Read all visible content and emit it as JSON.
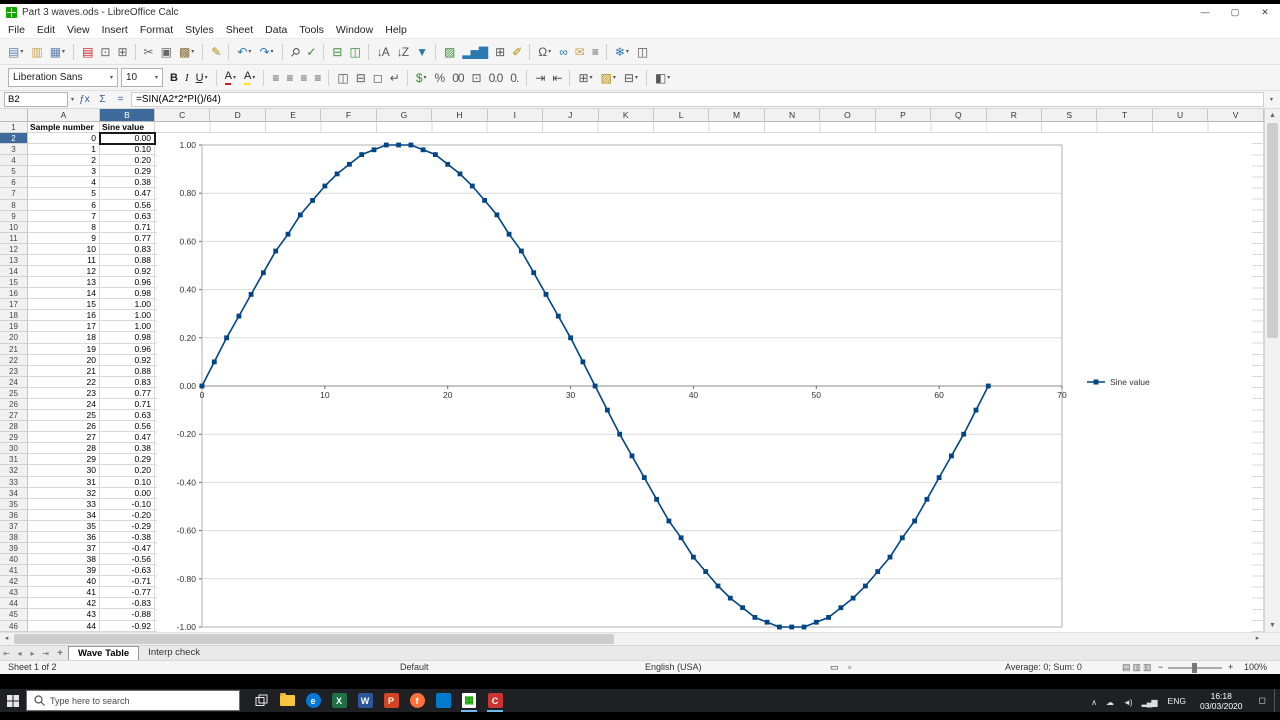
{
  "ui": {
    "dropdown": "▾",
    "up_arrow": "▲",
    "down_arrow": "▼",
    "left_arrow": "◂",
    "right_arrow": "▸"
  },
  "window": {
    "title": "Part 3 waves.ods - LibreOffice Calc",
    "controls": {
      "minimize": "—",
      "maximize": "▢",
      "close": "✕"
    }
  },
  "menu": {
    "items": [
      "File",
      "Edit",
      "View",
      "Insert",
      "Format",
      "Styles",
      "Sheet",
      "Data",
      "Tools",
      "Window",
      "Help"
    ]
  },
  "toolbar_main": {
    "icons": [
      {
        "n": "new-document",
        "g": "▤",
        "c": "#5b7fae",
        "dd": true
      },
      {
        "n": "open",
        "g": "▥",
        "c": "#caa24a"
      },
      {
        "n": "save",
        "g": "▦",
        "c": "#5b7fae",
        "dd": true
      },
      {
        "sep": true
      },
      {
        "n": "export-as-pdf",
        "g": "▤",
        "c": "#c9211e"
      },
      {
        "n": "print",
        "g": "⊡",
        "c": "#666666"
      },
      {
        "n": "print-preview",
        "g": "⊞",
        "c": "#666666"
      },
      {
        "sep": true
      },
      {
        "n": "cut",
        "g": "✂",
        "c": "#666666"
      },
      {
        "n": "copy",
        "g": "▣",
        "c": "#666666"
      },
      {
        "n": "paste",
        "g": "▩",
        "c": "#8a6d3b",
        "dd": true
      },
      {
        "sep": true
      },
      {
        "n": "clone-formatting",
        "g": "✎",
        "c": "#b58900"
      },
      {
        "sep": true
      },
      {
        "n": "undo",
        "g": "↶",
        "c": "#2a7ab0",
        "dd": true
      },
      {
        "n": "redo",
        "g": "↷",
        "c": "#2a7ab0",
        "dd": true
      },
      {
        "sep": true
      },
      {
        "n": "find-and-replace",
        "g": "⚲",
        "c": "#555555",
        "cls": "rot45"
      },
      {
        "n": "spelling",
        "g": "✓",
        "c": "#3a8a3a"
      },
      {
        "sep": true
      },
      {
        "n": "insert-row",
        "g": "⊟",
        "c": "#3a8a3a"
      },
      {
        "n": "insert-column",
        "g": "◫",
        "c": "#3a8a3a"
      },
      {
        "sep": true
      },
      {
        "n": "sort-ascending",
        "g": "↓A",
        "c": "#555555"
      },
      {
        "n": "sort-descending",
        "g": "↓Z",
        "c": "#555555"
      },
      {
        "n": "autofilter",
        "g": "▼",
        "c": "#2a7ab0"
      },
      {
        "sep": true
      },
      {
        "n": "insert-image",
        "g": "▨",
        "c": "#3a8a3a"
      },
      {
        "n": "insert-chart",
        "g": "▂▅▇",
        "c": "#2a7ab0"
      },
      {
        "n": "insert-pivot-table",
        "g": "⊞",
        "c": "#555555"
      },
      {
        "n": "show-draw-functions",
        "g": "✐",
        "c": "#b58900"
      },
      {
        "sep": true
      },
      {
        "n": "insert-special-character",
        "g": "Ω",
        "c": "#555555",
        "dd": true
      },
      {
        "n": "insert-hyperlink",
        "g": "∞",
        "c": "#2a7ab0"
      },
      {
        "n": "insert-comment",
        "g": "✉",
        "c": "#caa24a"
      },
      {
        "n": "headers-and-footers",
        "g": "≡",
        "c": "#555555"
      },
      {
        "sep": true
      },
      {
        "n": "freeze-rows-and-columns",
        "g": "❄",
        "c": "#2a7ab0",
        "dd": true
      },
      {
        "n": "split-window",
        "g": "◫",
        "c": "#555555"
      }
    ]
  },
  "toolbar_format": {
    "font_name": "Liberation Sans",
    "font_size": "10",
    "icons": [
      {
        "n": "bold",
        "g": "B",
        "cls": "bold"
      },
      {
        "n": "italic",
        "g": "I",
        "cls": "italic"
      },
      {
        "n": "underline",
        "g": "U",
        "cls": "underline",
        "dd": true
      },
      {
        "sep": true
      },
      {
        "n": "font-color",
        "g": "A",
        "cls": "fc-red",
        "dd": true
      },
      {
        "n": "highlighting-color",
        "g": "A",
        "cls": "fc-yellow",
        "dd": true
      },
      {
        "sep": true
      },
      {
        "n": "align-left",
        "g": "≡",
        "c": "#555555"
      },
      {
        "n": "align-center",
        "g": "≡",
        "c": "#555555"
      },
      {
        "n": "align-right",
        "g": "≡",
        "c": "#555555"
      },
      {
        "n": "align-justified",
        "g": "≡",
        "c": "#555555"
      },
      {
        "sep": true
      },
      {
        "n": "merge-and-center-cells",
        "g": "◫",
        "c": "#555555"
      },
      {
        "n": "merge-cells",
        "g": "⊟",
        "c": "#555555"
      },
      {
        "n": "unmerge-cells",
        "g": "◻",
        "c": "#555555"
      },
      {
        "n": "wrap-text",
        "g": "↵",
        "c": "#555555"
      },
      {
        "sep": true
      },
      {
        "n": "format-as-currency",
        "g": "$",
        "c": "#3a8a3a",
        "dd": true
      },
      {
        "n": "format-as-percent",
        "g": "%",
        "c": "#555555"
      },
      {
        "n": "format-as-number",
        "g": "00",
        "c": "#555555"
      },
      {
        "n": "format-as-date",
        "g": "⊡",
        "c": "#555555"
      },
      {
        "n": "add-decimal-place",
        "g": "0.0",
        "c": "#555555"
      },
      {
        "n": "delete-decimal-place",
        "g": "0.",
        "c": "#555555"
      },
      {
        "sep": true
      },
      {
        "n": "increase-indent",
        "g": "⇥",
        "c": "#555555"
      },
      {
        "n": "decrease-indent",
        "g": "⇤",
        "c": "#555555"
      },
      {
        "sep": true
      },
      {
        "n": "borders",
        "g": "⊞",
        "c": "#555555",
        "dd": true
      },
      {
        "n": "background-color",
        "g": "▨",
        "c": "#b58900",
        "dd": true
      },
      {
        "n": "border-style",
        "g": "⊟",
        "c": "#555555",
        "dd": true
      },
      {
        "sep": true
      },
      {
        "n": "conditional-formatting",
        "g": "◧",
        "c": "#555555",
        "dd": true
      }
    ]
  },
  "formula_bar": {
    "cell_reference": "B2",
    "fx": "ƒx",
    "sum": "Σ",
    "equals": "=",
    "formula": "=SIN(A2*2*PI()/64)"
  },
  "spreadsheet": {
    "columns": [
      "A",
      "B",
      "C",
      "D",
      "E",
      "F",
      "G",
      "H",
      "I",
      "J",
      "K",
      "L",
      "M",
      "N",
      "O",
      "P",
      "Q",
      "R",
      "S",
      "T",
      "U",
      "V"
    ],
    "selected_cell": "B2",
    "selected_column": "B",
    "selected_row": 2,
    "visible_row_count": 46,
    "header_row": [
      "Sample number",
      "Sine value"
    ],
    "rows": [
      [
        "0",
        "0.00"
      ],
      [
        "1",
        "0.10"
      ],
      [
        "2",
        "0.20"
      ],
      [
        "3",
        "0.29"
      ],
      [
        "4",
        "0.38"
      ],
      [
        "5",
        "0.47"
      ],
      [
        "6",
        "0.56"
      ],
      [
        "7",
        "0.63"
      ],
      [
        "8",
        "0.71"
      ],
      [
        "9",
        "0.77"
      ],
      [
        "10",
        "0.83"
      ],
      [
        "11",
        "0.88"
      ],
      [
        "12",
        "0.92"
      ],
      [
        "13",
        "0.96"
      ],
      [
        "14",
        "0.98"
      ],
      [
        "15",
        "1.00"
      ],
      [
        "16",
        "1.00"
      ],
      [
        "17",
        "1.00"
      ],
      [
        "18",
        "0.98"
      ],
      [
        "19",
        "0.96"
      ],
      [
        "20",
        "0.92"
      ],
      [
        "21",
        "0.88"
      ],
      [
        "22",
        "0.83"
      ],
      [
        "23",
        "0.77"
      ],
      [
        "24",
        "0.71"
      ],
      [
        "25",
        "0.63"
      ],
      [
        "26",
        "0.56"
      ],
      [
        "27",
        "0.47"
      ],
      [
        "28",
        "0.38"
      ],
      [
        "29",
        "0.29"
      ],
      [
        "30",
        "0.20"
      ],
      [
        "31",
        "0.10"
      ],
      [
        "32",
        "0.00"
      ],
      [
        "33",
        "-0.10"
      ],
      [
        "34",
        "-0.20"
      ],
      [
        "35",
        "-0.29"
      ],
      [
        "36",
        "-0.38"
      ],
      [
        "37",
        "-0.47"
      ],
      [
        "38",
        "-0.56"
      ],
      [
        "39",
        "-0.63"
      ],
      [
        "40",
        "-0.71"
      ],
      [
        "41",
        "-0.77"
      ],
      [
        "42",
        "-0.83"
      ],
      [
        "43",
        "-0.88"
      ],
      [
        "44",
        "-0.92"
      ]
    ]
  },
  "chart_data": {
    "type": "line",
    "title": "",
    "xlabel": "",
    "ylabel": "",
    "xlim": [
      0,
      70
    ],
    "ylim": [
      -1,
      1
    ],
    "x_ticks": [
      0,
      10,
      20,
      30,
      40,
      50,
      60,
      70
    ],
    "y_ticks": [
      "1.00",
      "0.80",
      "0.60",
      "0.40",
      "0.20",
      "0.00",
      "-0.20",
      "-0.40",
      "-0.60",
      "-0.80",
      "-1.00"
    ],
    "grid": true,
    "legend": {
      "position": "right"
    },
    "x": [
      0,
      1,
      2,
      3,
      4,
      5,
      6,
      7,
      8,
      9,
      10,
      11,
      12,
      13,
      14,
      15,
      16,
      17,
      18,
      19,
      20,
      21,
      22,
      23,
      24,
      25,
      26,
      27,
      28,
      29,
      30,
      31,
      32,
      33,
      34,
      35,
      36,
      37,
      38,
      39,
      40,
      41,
      42,
      43,
      44,
      45,
      46,
      47,
      48,
      49,
      50,
      51,
      52,
      53,
      54,
      55,
      56,
      57,
      58,
      59,
      60,
      61,
      62,
      63,
      64
    ],
    "series": [
      {
        "name": "Sine value",
        "color": "#004586",
        "marker": "square",
        "values": [
          0.0,
          0.1,
          0.2,
          0.29,
          0.38,
          0.47,
          0.56,
          0.63,
          0.71,
          0.77,
          0.83,
          0.88,
          0.92,
          0.96,
          0.98,
          1.0,
          1.0,
          1.0,
          0.98,
          0.96,
          0.92,
          0.88,
          0.83,
          0.77,
          0.71,
          0.63,
          0.56,
          0.47,
          0.38,
          0.29,
          0.2,
          0.1,
          0.0,
          -0.1,
          -0.2,
          -0.29,
          -0.38,
          -0.47,
          -0.56,
          -0.63,
          -0.71,
          -0.77,
          -0.83,
          -0.88,
          -0.92,
          -0.96,
          -0.98,
          -1.0,
          -1.0,
          -1.0,
          -0.98,
          -0.96,
          -0.92,
          -0.88,
          -0.83,
          -0.77,
          -0.71,
          -0.63,
          -0.56,
          -0.47,
          -0.38,
          -0.29,
          -0.2,
          -0.1,
          0.0
        ]
      }
    ]
  },
  "sheet_tabs": {
    "nav": [
      {
        "n": "first-sheet",
        "g": "⇤"
      },
      {
        "n": "previous-sheet",
        "g": "◂"
      },
      {
        "n": "next-sheet",
        "g": "▸"
      },
      {
        "n": "last-sheet",
        "g": "⇥"
      }
    ],
    "add": "+",
    "tabs": [
      {
        "label": "Wave Table",
        "active": true
      },
      {
        "label": "Interp check",
        "active": false
      }
    ]
  },
  "status_bar": {
    "sheet_info": "Sheet 1 of 2",
    "page_style": "Default",
    "language": "English (USA)",
    "selection_mode_glyph": "▭",
    "modified_glyph": "▫",
    "view_layout_glyphs": [
      "▤",
      "▥",
      "▥"
    ],
    "selection_summary": "Average: 0; Sum: 0",
    "zoom_out": "−",
    "zoom_in": "+",
    "zoom": "100%"
  },
  "taskbar": {
    "search_placeholder": "Type here to search",
    "language": "ENG",
    "time": "16:18",
    "date": "03/03/2020",
    "apps": [
      {
        "n": "task-view",
        "type": "taskview"
      },
      {
        "n": "file-explorer",
        "type": "folder"
      },
      {
        "n": "edge",
        "type": "circle",
        "c": "#0078d7",
        "t": "e"
      },
      {
        "n": "excel",
        "type": "square",
        "c": "#1e7145",
        "t": "X"
      },
      {
        "n": "word",
        "type": "square",
        "c": "#2b579a",
        "t": "W"
      },
      {
        "n": "powerpoint",
        "type": "square",
        "c": "#d04423",
        "t": "P"
      },
      {
        "n": "firefox",
        "type": "circle",
        "c": "#ff7139",
        "t": "f"
      },
      {
        "n": "vscode",
        "type": "square",
        "c": "#007acc",
        "t": ""
      },
      {
        "n": "libreoffice-calc",
        "type": "doc",
        "c": "#18a303",
        "running": true
      },
      {
        "n": "screen-recorder",
        "type": "square",
        "c": "#cc3333",
        "t": "C",
        "running": true
      }
    ],
    "tray_icons": [
      {
        "n": "hidden-icons",
        "g": "∧"
      },
      {
        "n": "onedrive",
        "g": "☁"
      },
      {
        "n": "speaker",
        "g": "◄)"
      },
      {
        "n": "network",
        "g": "▂▄▆"
      }
    ],
    "action_center_glyph": "◻"
  }
}
